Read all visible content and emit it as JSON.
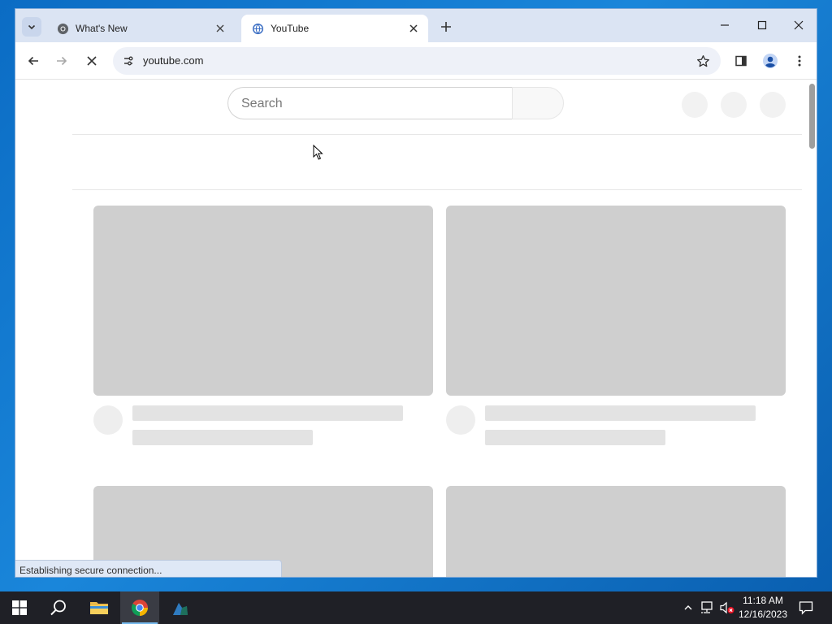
{
  "browser": {
    "tabs": [
      {
        "title": "What's New",
        "favicon": "chrome-icon",
        "active": false
      },
      {
        "title": "YouTube",
        "favicon": "loading-globe-icon",
        "active": true
      }
    ],
    "url": "youtube.com",
    "status_text": "Establishing secure connection..."
  },
  "youtube": {
    "search_placeholder": "Search"
  },
  "taskbar": {
    "apps": [
      "windows-start",
      "search",
      "file-explorer",
      "google-chrome",
      "python-idle"
    ],
    "clock_time": "11:18 AM",
    "clock_date": "12/16/2023"
  },
  "colors": {
    "tabstrip_bg": "#dbe4f3",
    "skeleton_thumb": "#cfcfcf",
    "skeleton_line": "#e3e3e3",
    "taskbar_bg": "#1f2026",
    "desktop_blue": "#0a72c8"
  }
}
